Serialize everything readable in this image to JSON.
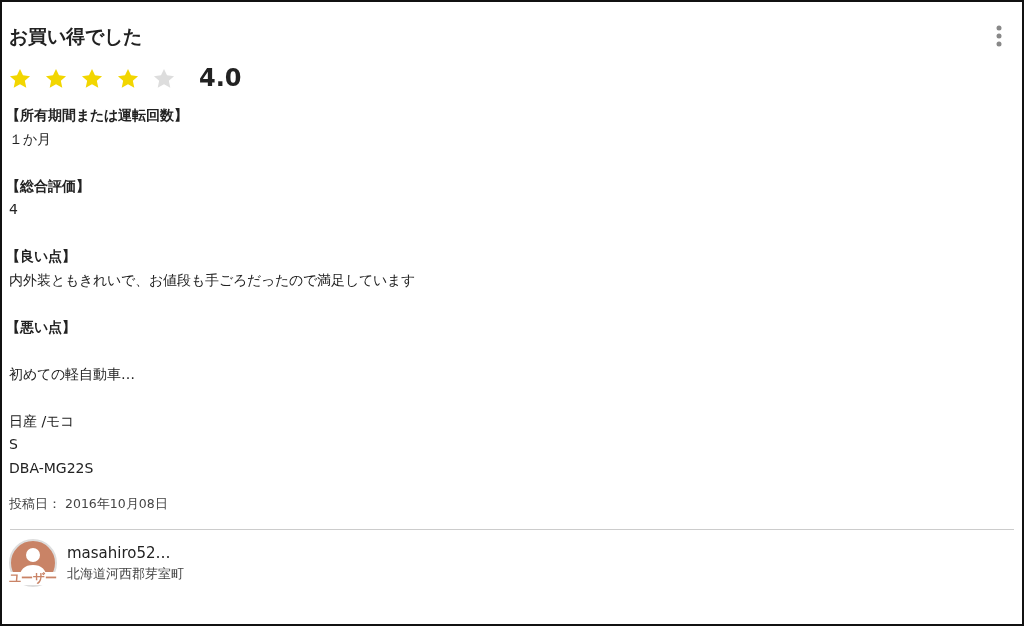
{
  "review": {
    "title": "お買い得でした",
    "stars": 4,
    "rating": "4.0",
    "sections": [
      {
        "heading": "【所有期間または運転回数】",
        "value": "１か月"
      },
      {
        "heading": "【総合評価】",
        "value": "4"
      },
      {
        "heading": "【良い点】",
        "value": "内外装ともきれいで、お値段も手ごろだったので満足しています"
      },
      {
        "heading": "【悪い点】"
      }
    ],
    "summary": "初めての軽自動車…",
    "vehicle": [
      "日産 /モコ",
      "S",
      "DBA-MG22S"
    ],
    "posted": "投稿日： 2016年10月08日"
  },
  "author": {
    "avatar_label": "ユーザー",
    "name": "masahiro52…",
    "location": "北海道河西郡芽室町"
  }
}
